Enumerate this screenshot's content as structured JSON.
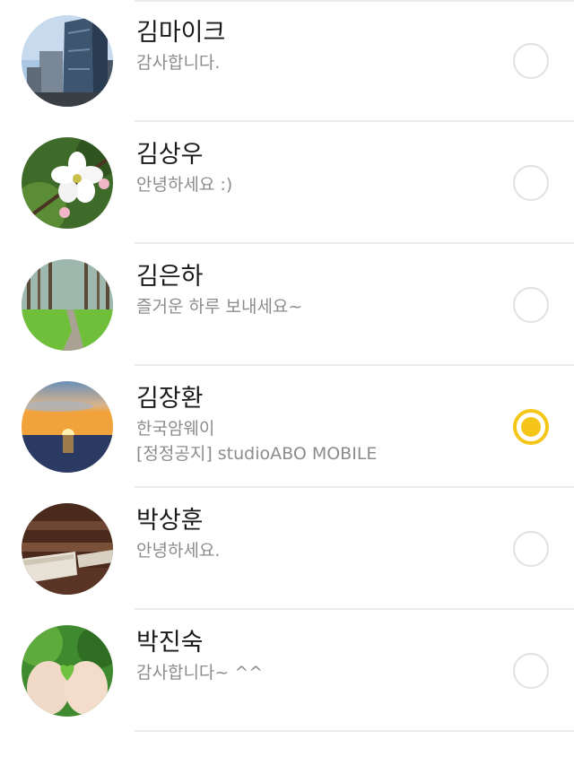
{
  "accent_color": "#f5c518",
  "contacts": [
    {
      "name": "김마이크",
      "status": "감사합니다.",
      "status2": "",
      "selected": false
    },
    {
      "name": "김상우",
      "status": "안녕하세요 :)",
      "status2": "",
      "selected": false
    },
    {
      "name": "김은하",
      "status": "즐거운 하루 보내세요~",
      "status2": "",
      "selected": false
    },
    {
      "name": "김장환",
      "status": "한국암웨이",
      "status2": "[정정공지] studioABO MOBILE",
      "selected": true
    },
    {
      "name": "박상훈",
      "status": "안녕하세요.",
      "status2": "",
      "selected": false
    },
    {
      "name": "박진숙",
      "status": "감사합니다~ ^^",
      "status2": "",
      "selected": false
    }
  ]
}
